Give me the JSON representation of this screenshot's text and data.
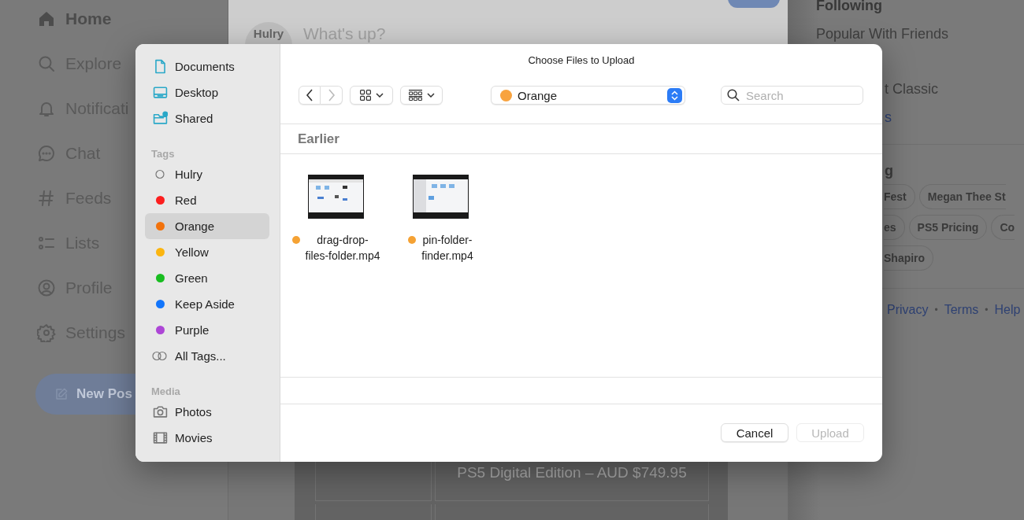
{
  "background": {
    "nav": [
      {
        "label": "Home",
        "kind": "home",
        "selected": true
      },
      {
        "label": "Explore",
        "kind": "search",
        "selected": false
      },
      {
        "label": "Notificati",
        "kind": "bell",
        "selected": false
      },
      {
        "label": "Chat",
        "kind": "chat",
        "selected": false
      },
      {
        "label": "Feeds",
        "kind": "hash",
        "selected": false
      },
      {
        "label": "Lists",
        "kind": "list",
        "selected": false
      },
      {
        "label": "Profile",
        "kind": "profile",
        "selected": false
      },
      {
        "label": "Settings",
        "kind": "gear",
        "selected": false
      }
    ],
    "new_post_button": "New Pos",
    "composer": {
      "avatar": "Hulry",
      "placeholder": "What's up?"
    },
    "product_caption": "PS5 Digital Edition – AUD $749.95",
    "feeds": [
      {
        "label": "Following",
        "kind": "heading"
      },
      {
        "label": "Popular With Friends",
        "kind": "feed"
      },
      {
        "label": "t Classic",
        "kind": "feed"
      },
      {
        "label": "s",
        "kind": "link"
      }
    ],
    "trending_heading": "g",
    "trending_rows": [
      [
        "Fest",
        "Megan Thee St"
      ],
      [
        "es",
        "PS5 Pricing",
        "Co"
      ],
      [
        "Shapiro"
      ]
    ],
    "footer": [
      {
        "kind": "link",
        "text": "Privacy"
      },
      {
        "kind": "separator",
        "text": "•"
      },
      {
        "kind": "link",
        "text": "Terms"
      },
      {
        "kind": "separator",
        "text": "•"
      },
      {
        "kind": "link",
        "text": "Help"
      }
    ]
  },
  "dialog": {
    "title": "Choose Files to Upload",
    "sidebar": [
      {
        "items": [
          {
            "label": "Documents",
            "kind": "document",
            "selected": false
          },
          {
            "label": "Desktop",
            "kind": "desktop",
            "selected": false
          },
          {
            "label": "Shared",
            "kind": "shared",
            "selected": false
          }
        ]
      },
      {
        "header": "Tags",
        "items": [
          {
            "label": "Hulry",
            "kind": "empty-tag",
            "selected": false
          },
          {
            "label": "Red",
            "kind": "tag",
            "color": "#fc1e1e",
            "selected": false
          },
          {
            "label": "Orange",
            "kind": "tag",
            "color": "#f2720c",
            "selected": true
          },
          {
            "label": "Yellow",
            "kind": "tag",
            "color": "#fbb510",
            "selected": false
          },
          {
            "label": "Green",
            "kind": "tag",
            "color": "#18bd20",
            "selected": false
          },
          {
            "label": "Keep Aside",
            "kind": "tag",
            "color": "#1275fb",
            "selected": false
          },
          {
            "label": "Purple",
            "kind": "tag",
            "color": "#ad46d6",
            "selected": false
          },
          {
            "label": "All Tags...",
            "kind": "all-tags",
            "selected": false
          }
        ]
      },
      {
        "header": "Media",
        "items": [
          {
            "label": "Photos",
            "kind": "camera",
            "selected": false
          },
          {
            "label": "Movies",
            "kind": "film",
            "selected": false
          }
        ]
      }
    ],
    "location": {
      "label": "Orange",
      "color": "#f8a33f"
    },
    "search": {
      "placeholder": "Search"
    },
    "group": "Earlier",
    "files": [
      {
        "name": "drag-drop-\nfiles-folder.mp4",
        "color": "#f5a234"
      },
      {
        "name": "pin-folder-\nfinder.mp4",
        "color": "#f5a234"
      }
    ],
    "buttons": [
      {
        "label": "Cancel",
        "disabled": false
      },
      {
        "label": "Upload",
        "disabled": true
      }
    ]
  }
}
